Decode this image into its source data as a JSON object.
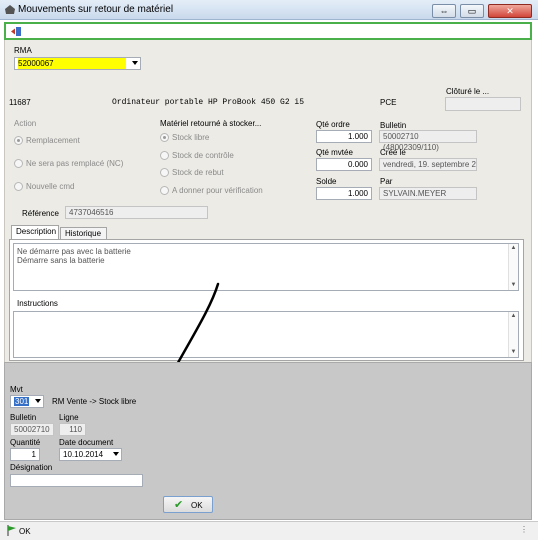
{
  "window": {
    "title": "Mouvements sur retour de matériel"
  },
  "header": {
    "rma_label": "RMA",
    "rma_value": "52000067",
    "cloture_label": "Clôturé le ...",
    "cloture_value": ""
  },
  "item": {
    "code": "11687",
    "description": "Ordinateur portable HP ProBook 450 G2 i5",
    "unit": "PCE"
  },
  "action": {
    "label": "Action",
    "options": [
      "Remplacement",
      "Ne sera pas remplacé (NC)",
      "Nouvelle cmd"
    ],
    "selected": "Remplacement"
  },
  "materiel": {
    "label": "Matériel retourné à stocker...",
    "options": [
      "Stock libre",
      "Stock de contrôle",
      "Stock de rebut",
      "A donner pour vérification"
    ],
    "selected": "Stock libre"
  },
  "quantities": {
    "qte_ordre_label": "Qté ordre",
    "qte_ordre": "1.000",
    "qte_mvtee_label": "Qté mvtée",
    "qte_mvtee": "0.000",
    "solde_label": "Solde",
    "solde": "1.000"
  },
  "info": {
    "bulletin_label": "Bulletin",
    "bulletin": "50002710 (48002309/110)",
    "cree_label": "Créé le",
    "cree": "vendredi, 19. septembre 2",
    "par_label": "Par",
    "par": "SYLVAIN.MEYER"
  },
  "reference": {
    "label": "Référence",
    "value": "4737046516"
  },
  "tabs": [
    "Description",
    "Historique"
  ],
  "description_text": [
    "Ne démarre pas avec la batterie",
    "Démarre sans la batterie"
  ],
  "instructions_label": "Instructions",
  "movement": {
    "mvt_label": "Mvt",
    "mvt_value": "301",
    "mvt_desc": "RM Vente -> Stock libre",
    "bulletin_label": "Bulletin",
    "bulletin_value": "50002710",
    "ligne_label": "Ligne",
    "ligne_value": "110",
    "quantite_label": "Quantité",
    "quantite_value": "1",
    "date_label": "Date document",
    "date_value": "10.10.2014",
    "designation_label": "Désignation",
    "designation_value": "",
    "ok_label": "OK"
  },
  "status": {
    "text": "OK"
  },
  "colors": {
    "rma_highlight": "#ffff00",
    "toolbar_border": "#4ab04a",
    "lower_panel": "#c8c8c8",
    "main_panel": "#ecebe6"
  }
}
